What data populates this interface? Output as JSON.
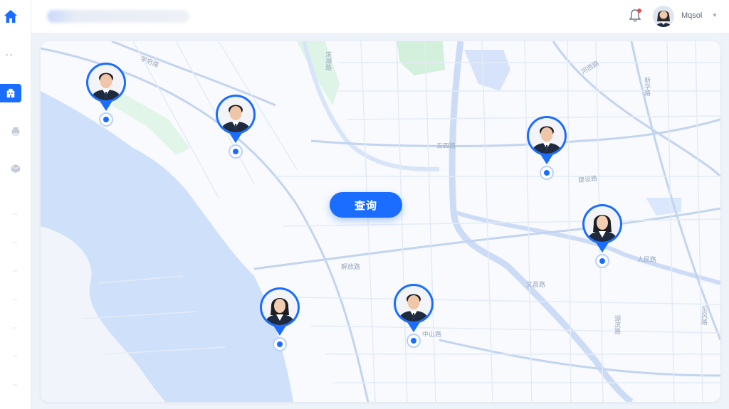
{
  "colors": {
    "accent": "#1a6dff",
    "notification": "#f04848",
    "water": "#cfe0fb",
    "park": "#d2f0dc"
  },
  "sidebar": {
    "logo_icon": "home-icon",
    "items": [
      {
        "icon": "building-icon",
        "active": true
      },
      {
        "icon": "printer-icon",
        "active": false
      },
      {
        "icon": "box-icon",
        "active": false
      }
    ]
  },
  "header": {
    "notification_icon": "bell-icon",
    "has_unread": true,
    "user": {
      "name": "Mqsol",
      "avatar_icon": "user-avatar-icon",
      "menu_icon": "caret-down-icon"
    }
  },
  "map": {
    "query_button_label": "查询",
    "street_labels": [
      "学府路",
      "滨湖路",
      "五四路",
      "建设路",
      "解放路",
      "文昌路",
      "人民路",
      "中山路",
      "新华路",
      "东风路",
      "湖滨路",
      "河西路"
    ],
    "people_pins": [
      {
        "person": "man-1",
        "icon": "man-portrait-icon"
      },
      {
        "person": "man-2",
        "icon": "man-portrait-icon"
      },
      {
        "person": "man-3",
        "icon": "man-portrait-icon"
      },
      {
        "person": "woman-1",
        "icon": "woman-portrait-icon"
      },
      {
        "person": "woman-2",
        "icon": "woman-portrait-icon"
      },
      {
        "person": "man-4",
        "icon": "man-portrait-icon"
      }
    ]
  }
}
